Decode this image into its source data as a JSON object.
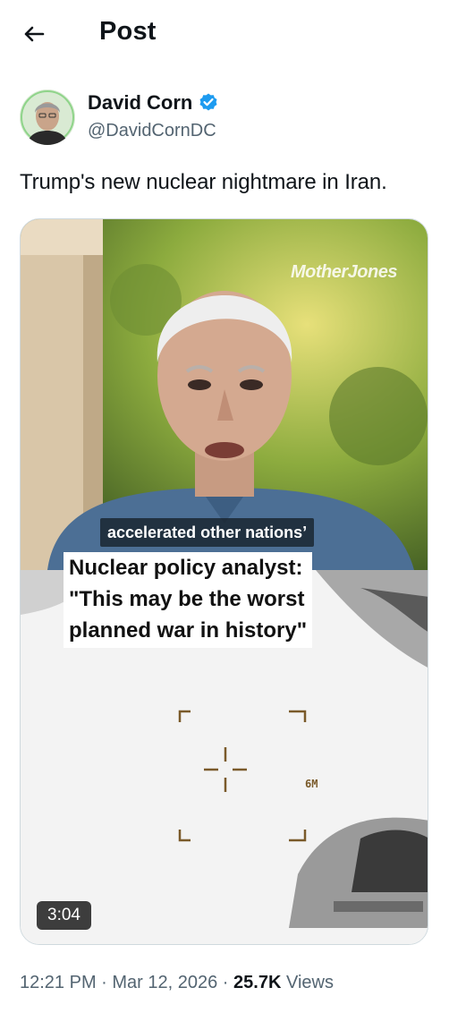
{
  "header": {
    "title": "Post",
    "back_icon": "arrow-left-icon"
  },
  "author": {
    "name": "David Corn",
    "handle": "@DavidCornDC",
    "verified_icon": "verified-badge-icon",
    "verified_color": "#1d9bf0"
  },
  "tweet": {
    "text": "Trump's new nuclear nightmare in Iran."
  },
  "media": {
    "watermark": "MotherJones",
    "caption": "accelerated other nations’",
    "headline_lines": [
      "Nuclear policy analyst:",
      "\"This may be the worst",
      "planned war in history\""
    ],
    "hud_label": "6M",
    "duration": "3:04"
  },
  "meta": {
    "time": "12:21 PM",
    "separator": " · ",
    "date": "Mar 12, 2026",
    "views_count": "25.7K",
    "views_label": "Views"
  }
}
